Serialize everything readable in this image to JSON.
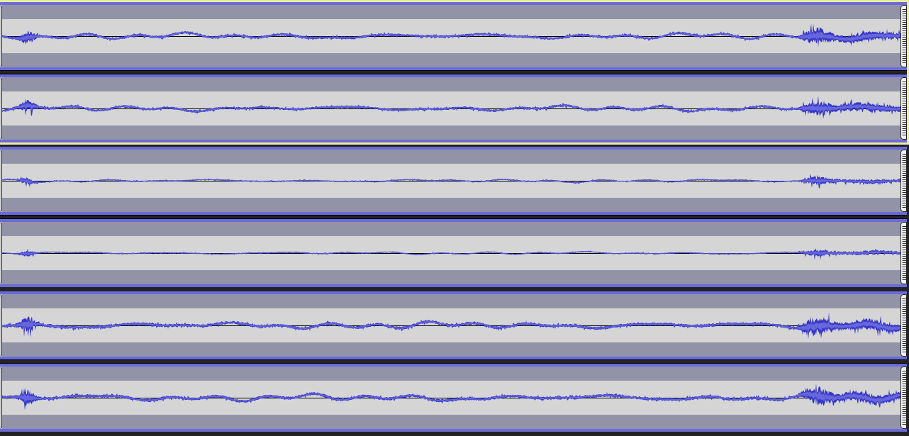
{
  "tracks": [
    {
      "focused": true,
      "channels": [
        {
          "kind": "waveform"
        },
        {
          "kind": "waveform"
        }
      ]
    },
    {
      "focused": false,
      "channels": [
        {
          "kind": "waveform"
        },
        {
          "kind": "waveform"
        }
      ]
    },
    {
      "focused": false,
      "channels": [
        {
          "kind": "waveform"
        },
        {
          "kind": "waveform"
        }
      ]
    }
  ]
}
